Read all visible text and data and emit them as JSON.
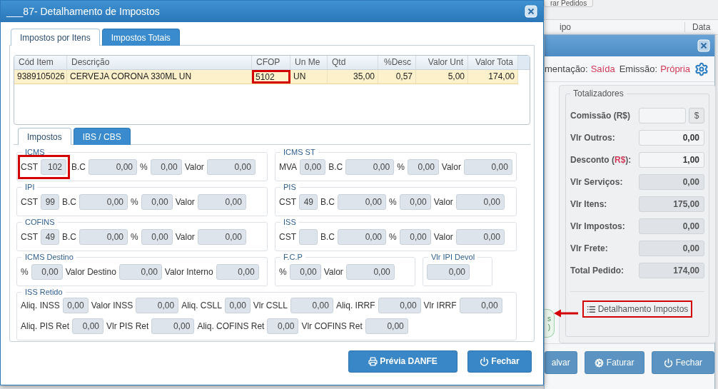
{
  "background": {
    "top_button": "rar Pedidos",
    "grid_headers": [
      "ipo",
      "Data"
    ],
    "window": {
      "header": [
        {
          "label": "mentação:",
          "value": "Saída"
        },
        {
          "label": "Emissão:",
          "value": "Própria"
        }
      ],
      "side_badge": [
        "s",
        ")"
      ],
      "totals": {
        "title": "Totalizadores",
        "rows": [
          {
            "label": "Comissão (R$)",
            "editable": true,
            "kind": "money"
          },
          {
            "label": "Vlr Outros:",
            "value": "0,00",
            "editable": true,
            "kind": "plain"
          },
          {
            "label": "Desconto (",
            "accent": "R$",
            "label_end": "):",
            "value": "1,00",
            "editable": true,
            "kind": "accent"
          },
          {
            "label": "Vlr Serviços:",
            "value": "0,00",
            "editable": false,
            "kind": "plain"
          },
          {
            "label": "Vlr Itens:",
            "value": "175,00",
            "editable": false,
            "kind": "plain"
          },
          {
            "label": "Vlr Impostos:",
            "value": "0,00",
            "editable": false,
            "kind": "plain"
          },
          {
            "label": "Vlr Frete:",
            "value": "0,00",
            "editable": false,
            "kind": "plain"
          },
          {
            "label": "Total Pedido:",
            "value": "174,00",
            "editable": false,
            "kind": "plain"
          }
        ],
        "money_button": "$",
        "detail_button": {
          "label": "Detalhamento Impostos",
          "highlighted": true
        }
      },
      "buttons": [
        {
          "label": "alvar"
        },
        {
          "label": "Faturar"
        },
        {
          "label": "Fechar"
        }
      ]
    }
  },
  "dialog": {
    "title": "___87- Detalhamento de Impostos",
    "tabs": [
      {
        "label": "Impostos por Itens",
        "selected": true
      },
      {
        "label": "Impostos Totais",
        "selected": false
      }
    ],
    "grid": {
      "columns": [
        "Cód Item",
        "Descrição",
        "CFOP",
        "Un Me",
        "Qtd",
        "%Desc",
        "Valor Unt",
        "Valor Tota"
      ],
      "rows": [
        {
          "selected": true,
          "cells": [
            {
              "text": "9389105026",
              "highlighted": false
            },
            {
              "text": "CERVEJA CORONA 330ML UN",
              "highlighted": false
            },
            {
              "text": "5102",
              "highlighted": true
            },
            {
              "text": "UN",
              "highlighted": false
            },
            {
              "text": "35,00",
              "highlighted": false
            },
            {
              "text": "0,57",
              "highlighted": false
            },
            {
              "text": "5,00",
              "highlighted": false
            },
            {
              "text": "174,00",
              "highlighted": false
            }
          ]
        }
      ]
    },
    "subtabs": [
      {
        "label": "Impostos",
        "selected": true
      },
      {
        "label": "IBS / CBS",
        "selected": false
      }
    ],
    "tax_rows": [
      [
        {
          "title": "ICMS",
          "fields": [
            {
              "label": "CST",
              "value": "102",
              "highlighted": true
            },
            {
              "label": "B.C",
              "value": "0,00",
              "highlighted": false
            },
            {
              "label": "%",
              "value": "0,00",
              "highlighted": false
            },
            {
              "label": "Valor",
              "value": "0,00",
              "highlighted": false
            }
          ]
        },
        {
          "title": "ICMS ST",
          "fields": [
            {
              "label": "MVA",
              "value": "0,00",
              "highlighted": false
            },
            {
              "label": "B.C",
              "value": "0,00",
              "highlighted": false
            },
            {
              "label": "%",
              "value": "0,00",
              "highlighted": false
            },
            {
              "label": "Valor",
              "value": "0,00",
              "highlighted": false
            }
          ]
        }
      ],
      [
        {
          "title": "IPI",
          "fields": [
            {
              "label": "CST",
              "value": "99",
              "highlighted": false
            },
            {
              "label": "B.C",
              "value": "0,00",
              "highlighted": false
            },
            {
              "label": "%",
              "value": "0,00",
              "highlighted": false
            },
            {
              "label": "Valor",
              "value": "0,00",
              "highlighted": false
            }
          ]
        },
        {
          "title": "PIS",
          "fields": [
            {
              "label": "CST",
              "value": "49",
              "highlighted": false
            },
            {
              "label": "B.C",
              "value": "0,00",
              "highlighted": false
            },
            {
              "label": "%",
              "value": "0,00",
              "highlighted": false
            },
            {
              "label": "Valor",
              "value": "0,00",
              "highlighted": false
            }
          ]
        }
      ],
      [
        {
          "title": "COFINS",
          "fields": [
            {
              "label": "CST",
              "value": "49",
              "highlighted": false
            },
            {
              "label": "B.C",
              "value": "0,00",
              "highlighted": false
            },
            {
              "label": "%",
              "value": "0,00",
              "highlighted": false
            },
            {
              "label": "Valor",
              "value": "0,00",
              "highlighted": false
            }
          ]
        },
        {
          "title": "ISS",
          "fields": [
            {
              "label": "CST",
              "highlighted": false
            },
            {
              "label": "B.C",
              "value": "0,00",
              "highlighted": false
            },
            {
              "label": "%",
              "value": "0,00",
              "highlighted": false
            },
            {
              "label": "Valor",
              "value": "0,00",
              "highlighted": false
            }
          ]
        }
      ],
      [
        {
          "title": "ICMS Destino",
          "fields": [
            {
              "label": "%",
              "value": "0,00",
              "highlighted": false
            },
            {
              "label": "Valor Destino",
              "value": "0,00",
              "highlighted": false
            },
            {
              "label": "Valor Interno",
              "value": "0,00",
              "highlighted": false
            }
          ]
        },
        {
          "title": "F.C.P",
          "fields": [
            {
              "label": "%",
              "value": "0,00",
              "highlighted": false
            },
            {
              "label": "Valor",
              "value": "0,00",
              "highlighted": false
            }
          ]
        },
        {
          "title": "Vlr IPI Devol",
          "fields": [
            {
              "value": "0,00",
              "highlighted": false
            }
          ]
        }
      ]
    ],
    "retido": {
      "title": "ISS Retido",
      "lines": [
        [
          {
            "label": "Aliq. INSS",
            "value": "0,00",
            "highlighted": false
          },
          {
            "label": "Valor INSS",
            "value": "0,00",
            "highlighted": false
          },
          {
            "label": "Aliq. CSLL",
            "value": "0,00",
            "highlighted": false
          },
          {
            "label": "Vlr CSLL",
            "value": "0,00",
            "highlighted": false
          },
          {
            "label": "Aliq. IRRF",
            "value": "0,00",
            "highlighted": false
          },
          {
            "label": "Vlr IRRF",
            "value": "0,00",
            "highlighted": false
          }
        ],
        [
          {
            "label": "Aliq. PIS Ret",
            "value": "0,00",
            "highlighted": false
          },
          {
            "label": "Vlr PIS Ret",
            "value": "0,00",
            "highlighted": false
          },
          {
            "label": "Aliq. COFINS Ret",
            "value": "0,00",
            "highlighted": false
          },
          {
            "label": "Vlr COFINS Ret",
            "value": "0,00",
            "highlighted": false
          }
        ]
      ]
    },
    "buttons": [
      {
        "label": "Prévia DANFE"
      },
      {
        "label": "Fechar"
      }
    ]
  }
}
